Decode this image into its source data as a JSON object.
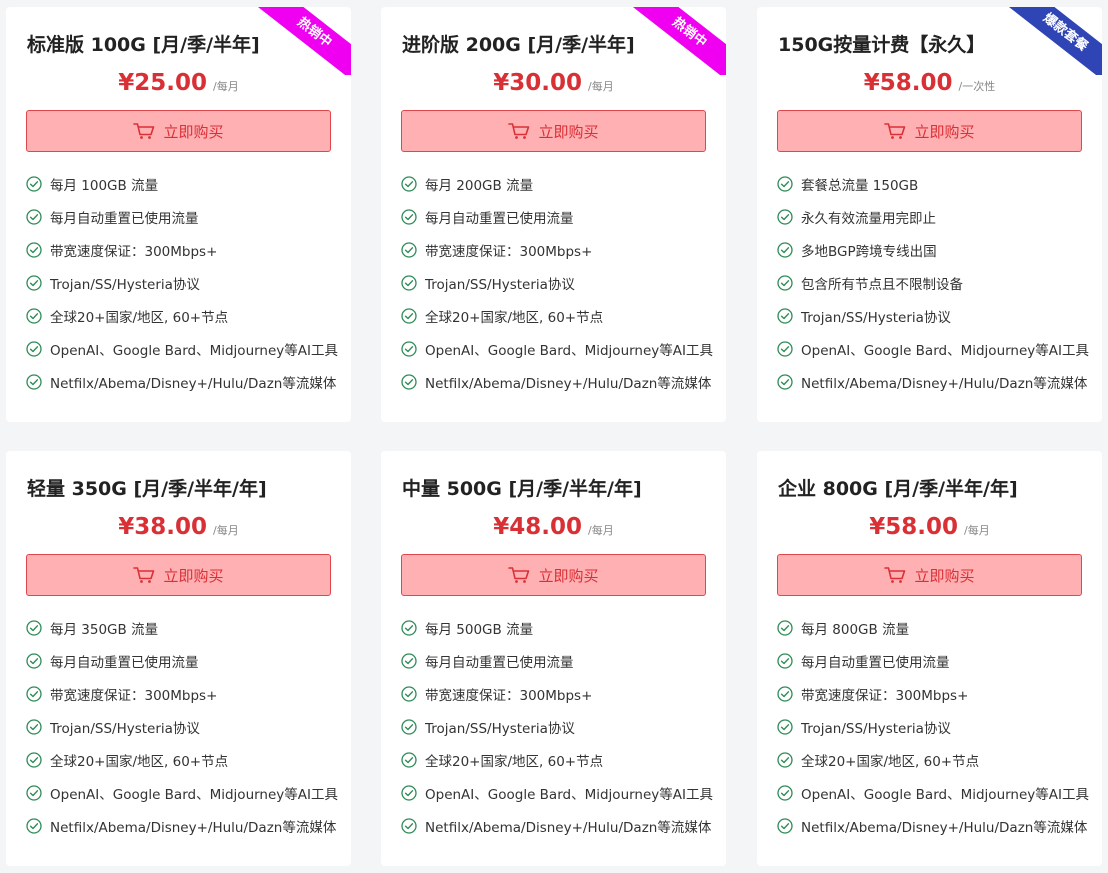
{
  "buy_label": "立即购买",
  "colors": {
    "price": "#d93036",
    "button_bg": "#ffb0b3",
    "button_border": "#e0474c",
    "check": "#2e8b57",
    "ribbon_hot": "#f000f0",
    "ribbon_promo": "#2f44b5"
  },
  "icons": {
    "buy": "cart-icon",
    "feature": "check-circle-icon"
  },
  "plans": [
    {
      "title": "标准版 100G [月/季/半年]",
      "price": "¥25.00",
      "period": "/每月",
      "ribbon": "热销中",
      "ribbon_color": "#f000f0",
      "features": [
        "每月 100GB 流量",
        "每月自动重置已使用流量",
        "带宽速度保证：300Mbps+",
        "Trojan/SS/Hysteria协议",
        "全球20+国家/地区, 60+节点",
        "OpenAI、Google Bard、Midjourney等AI工具",
        "Netfilx/Abema/Disney+/Hulu/Dazn等流媒体"
      ]
    },
    {
      "title": "进阶版 200G [月/季/半年]",
      "price": "¥30.00",
      "period": "/每月",
      "ribbon": "热销中",
      "ribbon_color": "#f000f0",
      "features": [
        "每月 200GB 流量",
        "每月自动重置已使用流量",
        "带宽速度保证：300Mbps+",
        "Trojan/SS/Hysteria协议",
        "全球20+国家/地区, 60+节点",
        "OpenAI、Google Bard、Midjourney等AI工具",
        "Netfilx/Abema/Disney+/Hulu/Dazn等流媒体"
      ]
    },
    {
      "title": "150G按量计费【永久】",
      "price": "¥58.00",
      "period": "/一次性",
      "ribbon": "爆款套餐",
      "ribbon_color": "#2f44b5",
      "features": [
        "套餐总流量 150GB",
        "永久有效流量用完即止",
        "多地BGP跨境专线出国",
        "包含所有节点且不限制设备",
        "Trojan/SS/Hysteria协议",
        "OpenAI、Google Bard、Midjourney等AI工具",
        "Netfilx/Abema/Disney+/Hulu/Dazn等流媒体"
      ]
    },
    {
      "title": "轻量 350G [月/季/半年/年]",
      "price": "¥38.00",
      "period": "/每月",
      "ribbon": "",
      "ribbon_color": "",
      "features": [
        "每月 350GB 流量",
        "每月自动重置已使用流量",
        "带宽速度保证：300Mbps+",
        "Trojan/SS/Hysteria协议",
        "全球20+国家/地区, 60+节点",
        "OpenAI、Google Bard、Midjourney等AI工具",
        "Netfilx/Abema/Disney+/Hulu/Dazn等流媒体"
      ]
    },
    {
      "title": "中量 500G [月/季/半年/年]",
      "price": "¥48.00",
      "period": "/每月",
      "ribbon": "",
      "ribbon_color": "",
      "features": [
        "每月 500GB 流量",
        "每月自动重置已使用流量",
        "带宽速度保证：300Mbps+",
        "Trojan/SS/Hysteria协议",
        "全球20+国家/地区, 60+节点",
        "OpenAI、Google Bard、Midjourney等AI工具",
        "Netfilx/Abema/Disney+/Hulu/Dazn等流媒体"
      ]
    },
    {
      "title": "企业 800G [月/季/半年/年]",
      "price": "¥58.00",
      "period": "/每月",
      "ribbon": "",
      "ribbon_color": "",
      "features": [
        "每月 800GB 流量",
        "每月自动重置已使用流量",
        "带宽速度保证：300Mbps+",
        "Trojan/SS/Hysteria协议",
        "全球20+国家/地区, 60+节点",
        "OpenAI、Google Bard、Midjourney等AI工具",
        "Netfilx/Abema/Disney+/Hulu/Dazn等流媒体"
      ]
    }
  ]
}
